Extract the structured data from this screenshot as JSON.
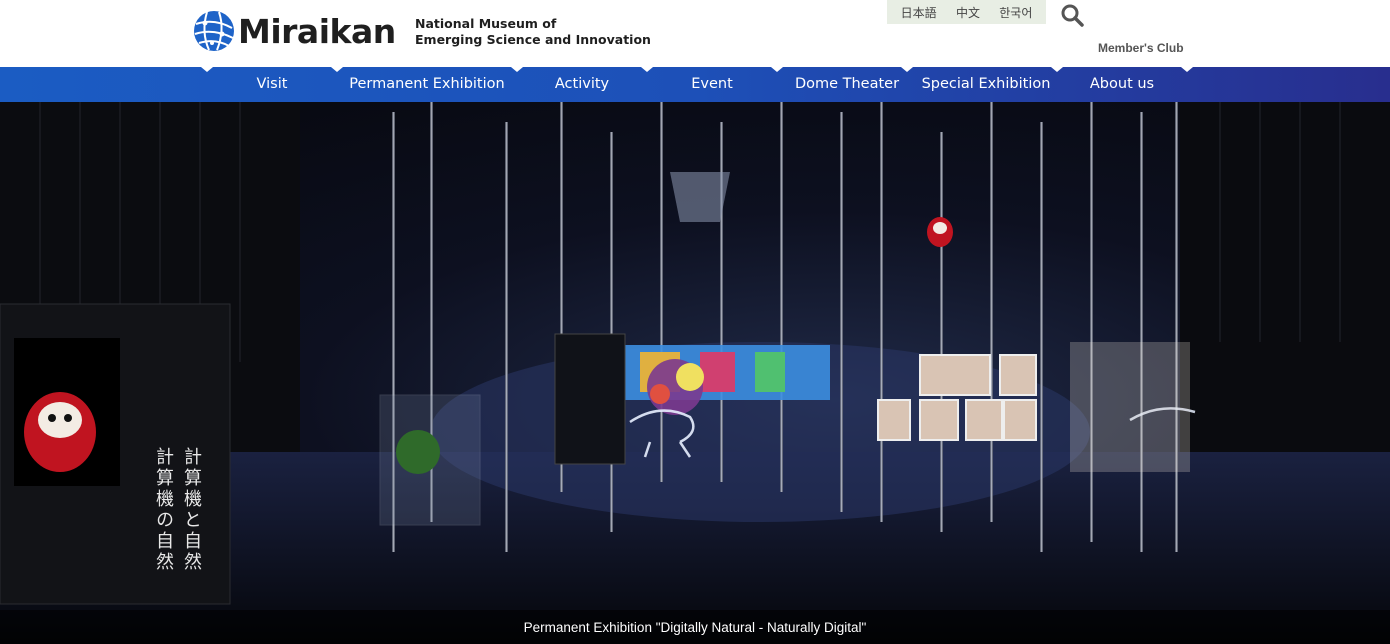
{
  "header": {
    "logo_text": "Miraikan",
    "subtitle_line1": "National Museum of",
    "subtitle_line2": "Emerging Science and Innovation",
    "languages": [
      "日本語",
      "中文",
      "한국어"
    ],
    "member_club": "Member's Club",
    "search_icon": "search-icon"
  },
  "nav": {
    "items": [
      {
        "label": "Visit"
      },
      {
        "label": "Permanent Exhibition"
      },
      {
        "label": "Activity"
      },
      {
        "label": "Event"
      },
      {
        "label": "Dome Theater"
      },
      {
        "label": "Special Exhibition"
      },
      {
        "label": "About us"
      }
    ]
  },
  "hero": {
    "caption": "Permanent Exhibition \"Digitally Natural - Naturally Digital\"",
    "panel_calligraphy": "計算機と自然 計算機の自然"
  },
  "colors": {
    "nav_start": "#1b5cc3",
    "nav_end": "#282e8e",
    "lang_bg": "#e8eee4",
    "logo_blue": "#1e63c8"
  }
}
